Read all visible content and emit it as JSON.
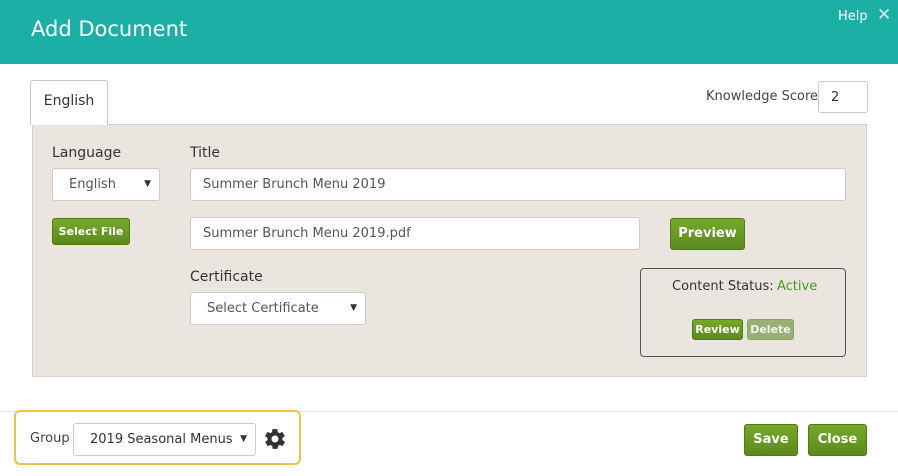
{
  "header": {
    "title": "Add Document",
    "help": "Help",
    "close_glyph": "✕"
  },
  "tabs": [
    {
      "label": "English"
    }
  ],
  "knowledge_score": {
    "label": "Knowledge Score",
    "value": "2"
  },
  "form": {
    "language_label": "Language",
    "language_value": "English",
    "title_label": "Title",
    "title_value": "Summer Brunch Menu 2019",
    "select_file_label": "Select File",
    "file_value": "Summer Brunch Menu 2019.pdf",
    "preview_label": "Preview",
    "certificate_label": "Certificate",
    "certificate_placeholder": "Select Certificate"
  },
  "content_status": {
    "label": "Content Status:",
    "value": "Active",
    "review_label": "Review",
    "delete_label": "Delete"
  },
  "footer": {
    "group_label": "Group",
    "group_value": "2019 Seasonal Menus",
    "save_label": "Save",
    "close_label": "Close"
  },
  "colors": {
    "header": "#1cafa6",
    "button_green": "#5b8a1c",
    "status_active": "#4a9a1c",
    "highlight": "#f2c14e",
    "panel": "#ebe5e0"
  },
  "icons": {
    "gear": "gear-icon",
    "dropdown": "caret-down-icon",
    "close": "close-icon"
  }
}
